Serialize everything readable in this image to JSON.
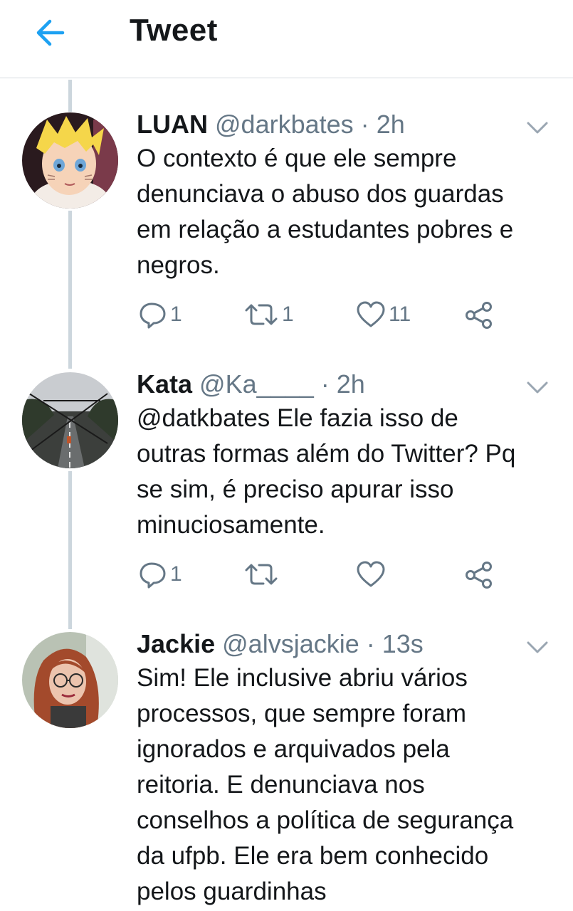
{
  "header": {
    "title": "Tweet",
    "back_icon": "back-arrow-icon"
  },
  "colors": {
    "accent": "#1da1f2",
    "secondary_text": "#657786",
    "thread_line": "#ccd6dd"
  },
  "tweets": [
    {
      "name": "LUAN",
      "handle": "@darkbates",
      "dot": "·",
      "time": "2h",
      "lines": [
        "O contexto é que ele sempre",
        "denunciava o abuso dos guardas",
        "em relação a estudantes pobres e",
        "negros."
      ],
      "replies": "1",
      "retweets": "1",
      "likes": "11"
    },
    {
      "name": "Kata",
      "handle": "@Ka____",
      "dot": "·",
      "time": "2h",
      "lines": [
        "@datkbates Ele fazia isso de",
        "outras formas além do Twitter? Pq",
        "se sim, é preciso apurar isso",
        "minuciosamente."
      ],
      "replies": "1",
      "retweets": "",
      "likes": ""
    },
    {
      "name": "Jackie",
      "handle": "@alvsjackie",
      "dot": "·",
      "time": "13s",
      "lines": [
        "Sim! Ele inclusive abriu vários",
        "processos, que sempre foram",
        "ignorados e arquivados pela",
        "reitoria. E denunciava nos",
        "conselhos a política de segurança",
        "da ufpb. Ele era bem conhecido",
        "pelos guardinhas"
      ]
    }
  ]
}
